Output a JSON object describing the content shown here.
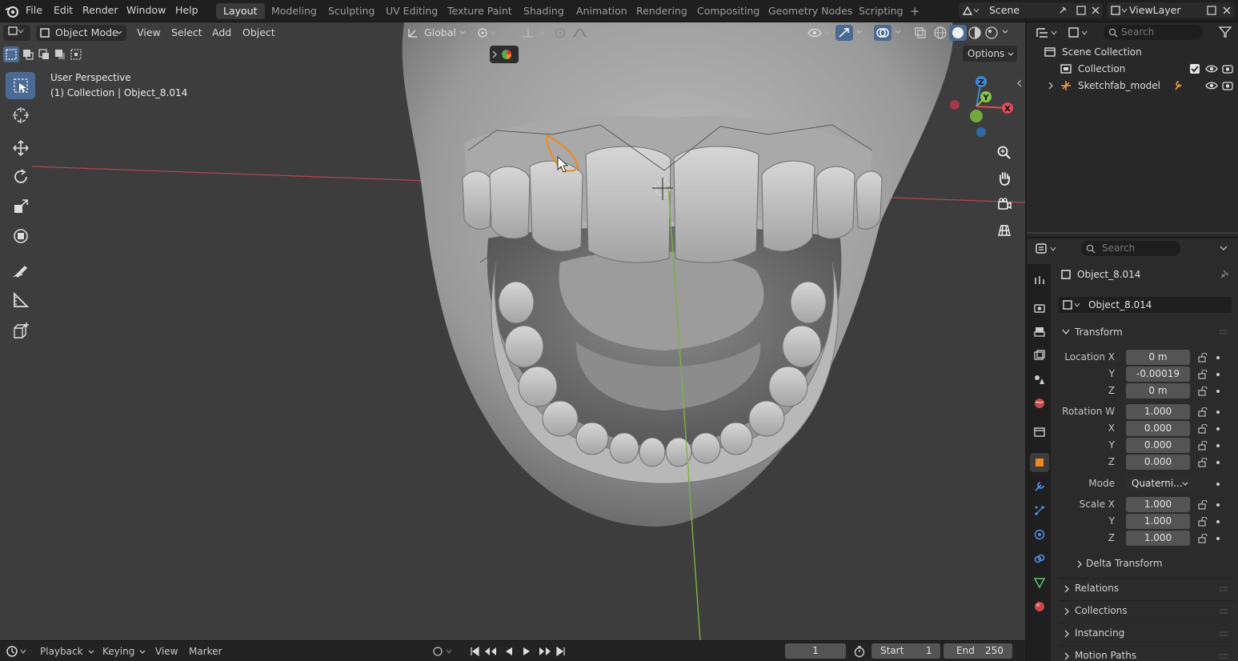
{
  "topbar": {
    "menus": [
      "File",
      "Edit",
      "Render",
      "Window",
      "Help"
    ],
    "workspaces": [
      "Layout",
      "Modeling",
      "Sculpting",
      "UV Editing",
      "Texture Paint",
      "Shading",
      "Animation",
      "Rendering",
      "Compositing",
      "Geometry Nodes",
      "Scripting"
    ],
    "active_workspace": "Layout",
    "add_workspace": "+",
    "scene_name": "Scene",
    "view_layer": "ViewLayer"
  },
  "viewport_header": {
    "mode": "Object Mode",
    "menus": [
      "View",
      "Select",
      "Add",
      "Object"
    ],
    "orientation": "Global",
    "options_label": "Options"
  },
  "viewport": {
    "perspective_label": "User Perspective",
    "collection_label": "(1) Collection | Object_8.014",
    "gizmo_axes": [
      "Z",
      "Y",
      "X"
    ]
  },
  "timeline": {
    "menus": [
      "Playback",
      "Keying",
      "View",
      "Marker"
    ],
    "current_frame": "1",
    "start_label": "Start",
    "start_value": "1",
    "end_label": "End",
    "end_value": "250"
  },
  "outliner": {
    "search_placeholder": "Search",
    "items": [
      {
        "label": "Scene Collection"
      },
      {
        "label": "Collection"
      },
      {
        "label": "Sketchfab_model"
      }
    ]
  },
  "properties": {
    "search_placeholder": "Search",
    "object_name": "Object_8.014",
    "object_field": "Object_8.014",
    "transform_header": "Transform",
    "location": {
      "label_x": "Location X",
      "x": "0 m",
      "label_y": "Y",
      "y": "-0.00019",
      "label_z": "Z",
      "z": "0 m"
    },
    "rotation": {
      "label_w": "Rotation W",
      "w": "1.000",
      "label_x": "X",
      "x": "0.000",
      "label_y": "Y",
      "y": "0.000",
      "label_z": "Z",
      "z": "0.000"
    },
    "mode_label": "Mode",
    "mode_value": "Quaterni...",
    "scale": {
      "label_x": "Scale X",
      "x": "1.000",
      "label_y": "Y",
      "y": "1.000",
      "label_z": "Z",
      "z": "1.000"
    },
    "delta_transform": "Delta Transform",
    "panels": [
      "Relations",
      "Collections",
      "Instancing",
      "Motion Paths"
    ]
  },
  "colors": {
    "accent_blue": "#4b6a93",
    "axis_x": "#e04a5b",
    "axis_y": "#8bc34a",
    "axis_z": "#3d88d6",
    "selection_orange": "#f08a1c"
  }
}
